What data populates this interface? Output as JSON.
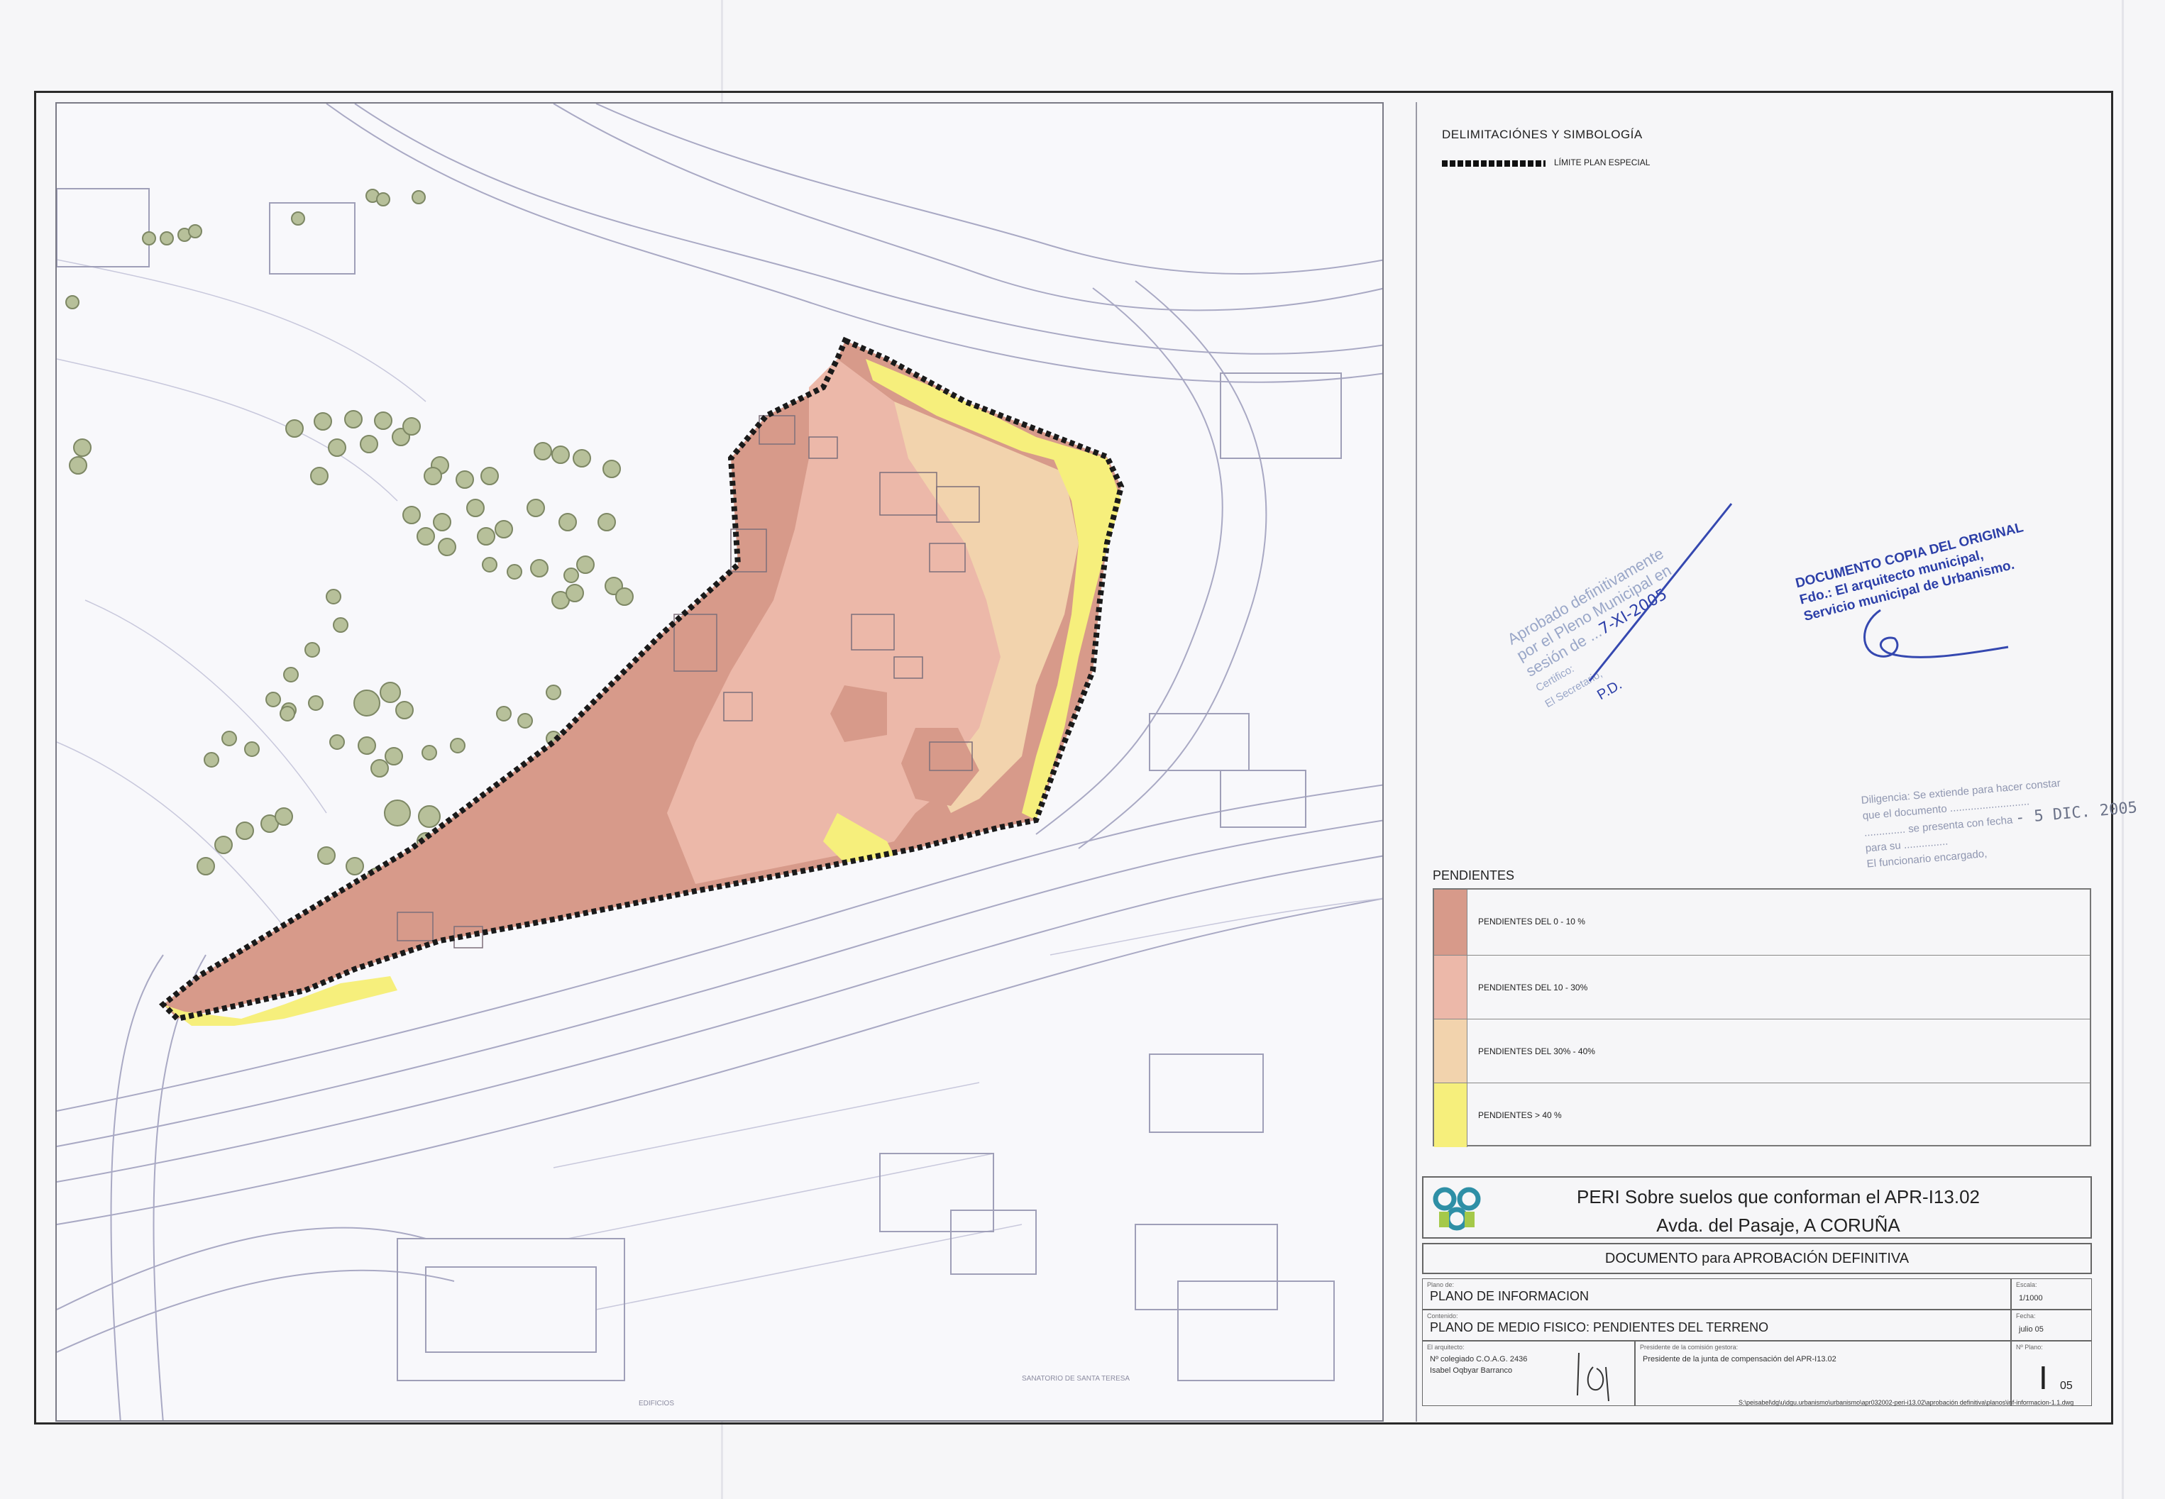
{
  "legend": {
    "delimitations_title": "DELIMITACIÓNES Y SIMBOLOGÍA",
    "boundary_label": "LÍMITE PLAN ESPECIAL",
    "slopes_title": "PENDIENTES",
    "slopes": [
      {
        "label": "PENDIENTES DEL 0 - 10 %",
        "color": "#d79a8a"
      },
      {
        "label": "PENDIENTES DEL 10 - 30%",
        "color": "#ecb8a9"
      },
      {
        "label": "PENDIENTES DEL 30% - 40%",
        "color": "#f2d3ad"
      },
      {
        "label": "PENDIENTES > 40 %",
        "color": "#f6ef7c"
      }
    ]
  },
  "title_block": {
    "project_line1": "PERI Sobre suelos que conforman el APR-I13.02",
    "project_line2": "Avda. del Pasaje,   A CORUÑA",
    "document": "DOCUMENTO para APROBACIÓN DEFINITIVA",
    "plan_label": "Plano de:",
    "plan_title": "PLANO DE INFORMACION",
    "content_label": "Contenido:",
    "content_title": "PLANO DE MEDIO FISICO: PENDIENTES DEL TERRENO",
    "scale_label": "Escala:",
    "scale": "1/1000",
    "date_label": "Fecha:",
    "date": "julio 05",
    "architect_label": "El arquitecto:",
    "architect_number": "Nº colegiado C.O.A.G. 2436",
    "architect_name": "Isabel Oqbyar Barranco",
    "president_label": "Presidente de la comisión gestora:",
    "president_text": "Presidente de la junta de compensación del APR-I13.02",
    "sheet_label": "Nº Plano:",
    "sheet_series": "I",
    "sheet_number": "05",
    "file_path": "S:\\peisabel\\dg\\u\\dgu.urbanismo\\urbanismo\\apr032002-peri-i13.02\\aprobación definitiva\\planos\\inf-informacion-1.1.dwg"
  },
  "stamps": {
    "approval_line1": "Aprobado definitivamente",
    "approval_line2": "por el Pleno Municipal en",
    "approval_line3": "sesión de ...",
    "approval_date": "7-XI-2005",
    "approval_line4": "Certifico:",
    "approval_line5": "El Secretario,",
    "approval_initials": "P.D.",
    "copy_line1": "DOCUMENTO COPIA DEL ORIGINAL",
    "copy_line2": "Fdo.: El arquitecto municipal,",
    "copy_line3": "Servicio municipal de Urbanismo.",
    "diligencia_line1": "Diligencia: Se extiende para hacer constar",
    "diligencia_line2": "que el documento ...........................",
    "diligencia_line3": ".............. se presenta con fecha",
    "diligencia_date": "- 5 DIC. 2005",
    "diligencia_line4": "para su ...............",
    "diligencia_line5": "El funcionario encargado,"
  },
  "map_labels": {
    "street1": "Avda. del Pasaje",
    "block1": "EDIFICIOS",
    "block2": "SANATORIO DE SANTA TERESA"
  }
}
